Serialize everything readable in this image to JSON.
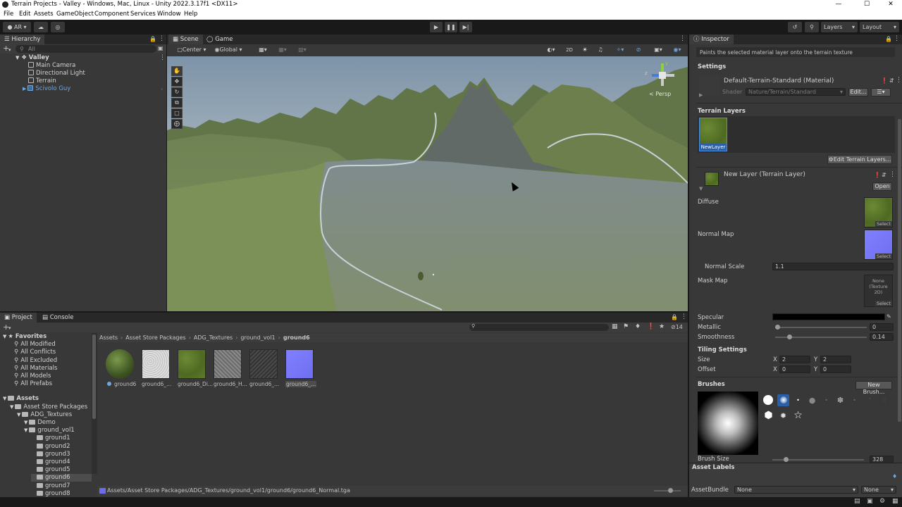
{
  "window": {
    "title": "Terrain Projects - Valley - Windows, Mac, Linux - Unity 2022.3.17f1 <DX11>",
    "controls": [
      "—",
      "☐",
      "✕"
    ]
  },
  "menu": [
    "File",
    "Edit",
    "Assets",
    "GameObject",
    "Component",
    "Services",
    "Window",
    "Help"
  ],
  "toolbar": {
    "account": "AR",
    "layers": "Layers",
    "layout": "Layout"
  },
  "hierarchy": {
    "tab": "Hierarchy",
    "search_placeholder": "All",
    "scene": "Valley",
    "items": [
      "Main Camera",
      "Directional Light",
      "Terrain",
      "Scivolo Guy"
    ]
  },
  "scene": {
    "tabs": [
      "Scene",
      "Game"
    ],
    "pivot": "Center",
    "space": "Global",
    "mode_2d": "2D",
    "persp": "< Persp",
    "gizmo_axes": [
      "y",
      "z"
    ]
  },
  "project": {
    "tabs": [
      "Project",
      "Console"
    ],
    "favorites_label": "Favorites",
    "favorites": [
      "All Modified",
      "All Conflicts",
      "All Excluded",
      "All Materials",
      "All Models",
      "All Prefabs"
    ],
    "tree": [
      {
        "label": "Assets",
        "indent": 0
      },
      {
        "label": "Asset Store Packages",
        "indent": 1
      },
      {
        "label": "ADG_Textures",
        "indent": 2
      },
      {
        "label": "Demo",
        "indent": 3
      },
      {
        "label": "ground_vol1",
        "indent": 3
      },
      {
        "label": "ground1",
        "indent": 4
      },
      {
        "label": "ground2",
        "indent": 4
      },
      {
        "label": "ground3",
        "indent": 4
      },
      {
        "label": "ground4",
        "indent": 4
      },
      {
        "label": "ground5",
        "indent": 4
      },
      {
        "label": "ground6",
        "indent": 4
      },
      {
        "label": "ground7",
        "indent": 4
      },
      {
        "label": "ground8",
        "indent": 4
      }
    ],
    "breadcrumb": [
      "Assets",
      "Asset Store Packages",
      "ADG_Textures",
      "ground_vol1",
      "ground6"
    ],
    "assets": [
      {
        "label": "ground6",
        "kind": "sphere"
      },
      {
        "label": "ground6_...",
        "kind": "white"
      },
      {
        "label": "ground6_Di...",
        "kind": "grass"
      },
      {
        "label": "ground6_H...",
        "kind": "grey"
      },
      {
        "label": "ground6_...",
        "kind": "dark"
      },
      {
        "label": "ground6_...",
        "kind": "normal"
      }
    ],
    "hidden_count": "14",
    "status_path": "Assets/Asset Store Packages/ADG_Textures/ground_vol1/ground6/ground6_Normal.tga"
  },
  "inspector": {
    "tab": "Inspector",
    "hint": "Paints the selected material layer onto the terrain texture",
    "settings": "Settings",
    "material": "Default-Terrain-Standard (Material)",
    "shader_label": "Shader",
    "shader_value": "Nature/Terrain/Standard",
    "edit_btn": "Edit...",
    "terrain_layers": "Terrain Layers",
    "layer_name": "NewLayer",
    "edit_layers_btn": "Edit Terrain Layers...",
    "layer_component": "New Layer (Terrain Layer)",
    "open_btn": "Open",
    "diffuse": "Diffuse",
    "normal_map": "Normal Map",
    "normal_scale_label": "Normal Scale",
    "normal_scale": "1.1",
    "mask_map": "Mask Map",
    "mask_none": "None",
    "mask_type": "(Texture 2D)",
    "select": "Select",
    "specular": "Specular",
    "metallic_label": "Metallic",
    "metallic": "0",
    "metallic_level": 0.0,
    "smoothness_label": "Smoothness",
    "smoothness": "0.14",
    "smoothness_level": 0.14,
    "tiling": "Tiling Settings",
    "size_label": "Size",
    "offset_label": "Offset",
    "x": "X",
    "y": "Y",
    "size_x": "2",
    "size_y": "2",
    "offset_x": "0",
    "offset_y": "0",
    "brushes": "Brushes",
    "new_brush_btn": "New Brush...",
    "brush_size_label": "Brush Size",
    "brush_size": "328",
    "brush_size_level": 0.13,
    "asset_labels": "Asset Labels",
    "asset_bundle_label": "AssetBundle",
    "bundle_value": "None",
    "variant_value": "None"
  }
}
